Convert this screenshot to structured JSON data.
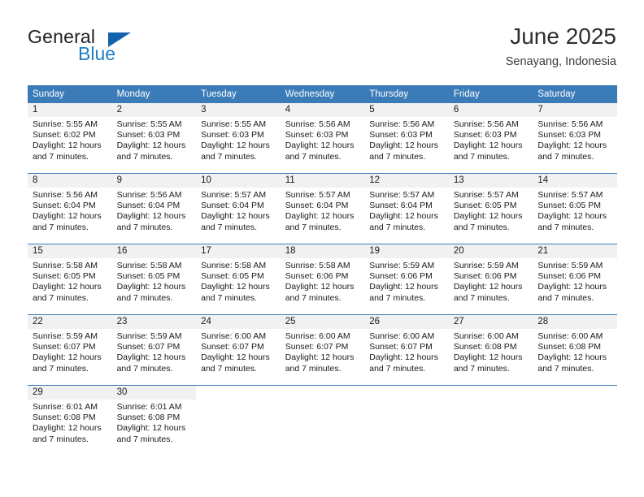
{
  "brand": {
    "name_part1": "General",
    "name_part2": "Blue"
  },
  "header": {
    "month_title": "June 2025",
    "location": "Senayang, Indonesia"
  },
  "colors": {
    "header_blue": "#3b7cb8",
    "logo_blue": "#1f7fc4",
    "date_band": "#f1f1f1"
  },
  "weekday_headers": [
    "Sunday",
    "Monday",
    "Tuesday",
    "Wednesday",
    "Thursday",
    "Friday",
    "Saturday"
  ],
  "labels": {
    "sunrise_prefix": "Sunrise:",
    "sunset_prefix": "Sunset:",
    "daylight_prefix": "Daylight:"
  },
  "weeks": [
    [
      {
        "day": "1",
        "sunrise": "Sunrise: 5:55 AM",
        "sunset": "Sunset: 6:02 PM",
        "daylight": "Daylight: 12 hours and 7 minutes."
      },
      {
        "day": "2",
        "sunrise": "Sunrise: 5:55 AM",
        "sunset": "Sunset: 6:03 PM",
        "daylight": "Daylight: 12 hours and 7 minutes."
      },
      {
        "day": "3",
        "sunrise": "Sunrise: 5:55 AM",
        "sunset": "Sunset: 6:03 PM",
        "daylight": "Daylight: 12 hours and 7 minutes."
      },
      {
        "day": "4",
        "sunrise": "Sunrise: 5:56 AM",
        "sunset": "Sunset: 6:03 PM",
        "daylight": "Daylight: 12 hours and 7 minutes."
      },
      {
        "day": "5",
        "sunrise": "Sunrise: 5:56 AM",
        "sunset": "Sunset: 6:03 PM",
        "daylight": "Daylight: 12 hours and 7 minutes."
      },
      {
        "day": "6",
        "sunrise": "Sunrise: 5:56 AM",
        "sunset": "Sunset: 6:03 PM",
        "daylight": "Daylight: 12 hours and 7 minutes."
      },
      {
        "day": "7",
        "sunrise": "Sunrise: 5:56 AM",
        "sunset": "Sunset: 6:03 PM",
        "daylight": "Daylight: 12 hours and 7 minutes."
      }
    ],
    [
      {
        "day": "8",
        "sunrise": "Sunrise: 5:56 AM",
        "sunset": "Sunset: 6:04 PM",
        "daylight": "Daylight: 12 hours and 7 minutes."
      },
      {
        "day": "9",
        "sunrise": "Sunrise: 5:56 AM",
        "sunset": "Sunset: 6:04 PM",
        "daylight": "Daylight: 12 hours and 7 minutes."
      },
      {
        "day": "10",
        "sunrise": "Sunrise: 5:57 AM",
        "sunset": "Sunset: 6:04 PM",
        "daylight": "Daylight: 12 hours and 7 minutes."
      },
      {
        "day": "11",
        "sunrise": "Sunrise: 5:57 AM",
        "sunset": "Sunset: 6:04 PM",
        "daylight": "Daylight: 12 hours and 7 minutes."
      },
      {
        "day": "12",
        "sunrise": "Sunrise: 5:57 AM",
        "sunset": "Sunset: 6:04 PM",
        "daylight": "Daylight: 12 hours and 7 minutes."
      },
      {
        "day": "13",
        "sunrise": "Sunrise: 5:57 AM",
        "sunset": "Sunset: 6:05 PM",
        "daylight": "Daylight: 12 hours and 7 minutes."
      },
      {
        "day": "14",
        "sunrise": "Sunrise: 5:57 AM",
        "sunset": "Sunset: 6:05 PM",
        "daylight": "Daylight: 12 hours and 7 minutes."
      }
    ],
    [
      {
        "day": "15",
        "sunrise": "Sunrise: 5:58 AM",
        "sunset": "Sunset: 6:05 PM",
        "daylight": "Daylight: 12 hours and 7 minutes."
      },
      {
        "day": "16",
        "sunrise": "Sunrise: 5:58 AM",
        "sunset": "Sunset: 6:05 PM",
        "daylight": "Daylight: 12 hours and 7 minutes."
      },
      {
        "day": "17",
        "sunrise": "Sunrise: 5:58 AM",
        "sunset": "Sunset: 6:05 PM",
        "daylight": "Daylight: 12 hours and 7 minutes."
      },
      {
        "day": "18",
        "sunrise": "Sunrise: 5:58 AM",
        "sunset": "Sunset: 6:06 PM",
        "daylight": "Daylight: 12 hours and 7 minutes."
      },
      {
        "day": "19",
        "sunrise": "Sunrise: 5:59 AM",
        "sunset": "Sunset: 6:06 PM",
        "daylight": "Daylight: 12 hours and 7 minutes."
      },
      {
        "day": "20",
        "sunrise": "Sunrise: 5:59 AM",
        "sunset": "Sunset: 6:06 PM",
        "daylight": "Daylight: 12 hours and 7 minutes."
      },
      {
        "day": "21",
        "sunrise": "Sunrise: 5:59 AM",
        "sunset": "Sunset: 6:06 PM",
        "daylight": "Daylight: 12 hours and 7 minutes."
      }
    ],
    [
      {
        "day": "22",
        "sunrise": "Sunrise: 5:59 AM",
        "sunset": "Sunset: 6:07 PM",
        "daylight": "Daylight: 12 hours and 7 minutes."
      },
      {
        "day": "23",
        "sunrise": "Sunrise: 5:59 AM",
        "sunset": "Sunset: 6:07 PM",
        "daylight": "Daylight: 12 hours and 7 minutes."
      },
      {
        "day": "24",
        "sunrise": "Sunrise: 6:00 AM",
        "sunset": "Sunset: 6:07 PM",
        "daylight": "Daylight: 12 hours and 7 minutes."
      },
      {
        "day": "25",
        "sunrise": "Sunrise: 6:00 AM",
        "sunset": "Sunset: 6:07 PM",
        "daylight": "Daylight: 12 hours and 7 minutes."
      },
      {
        "day": "26",
        "sunrise": "Sunrise: 6:00 AM",
        "sunset": "Sunset: 6:07 PM",
        "daylight": "Daylight: 12 hours and 7 minutes."
      },
      {
        "day": "27",
        "sunrise": "Sunrise: 6:00 AM",
        "sunset": "Sunset: 6:08 PM",
        "daylight": "Daylight: 12 hours and 7 minutes."
      },
      {
        "day": "28",
        "sunrise": "Sunrise: 6:00 AM",
        "sunset": "Sunset: 6:08 PM",
        "daylight": "Daylight: 12 hours and 7 minutes."
      }
    ],
    [
      {
        "day": "29",
        "sunrise": "Sunrise: 6:01 AM",
        "sunset": "Sunset: 6:08 PM",
        "daylight": "Daylight: 12 hours and 7 minutes."
      },
      {
        "day": "30",
        "sunrise": "Sunrise: 6:01 AM",
        "sunset": "Sunset: 6:08 PM",
        "daylight": "Daylight: 12 hours and 7 minutes."
      },
      {
        "day": "",
        "sunrise": "",
        "sunset": "",
        "daylight": ""
      },
      {
        "day": "",
        "sunrise": "",
        "sunset": "",
        "daylight": ""
      },
      {
        "day": "",
        "sunrise": "",
        "sunset": "",
        "daylight": ""
      },
      {
        "day": "",
        "sunrise": "",
        "sunset": "",
        "daylight": ""
      },
      {
        "day": "",
        "sunrise": "",
        "sunset": "",
        "daylight": ""
      }
    ]
  ]
}
